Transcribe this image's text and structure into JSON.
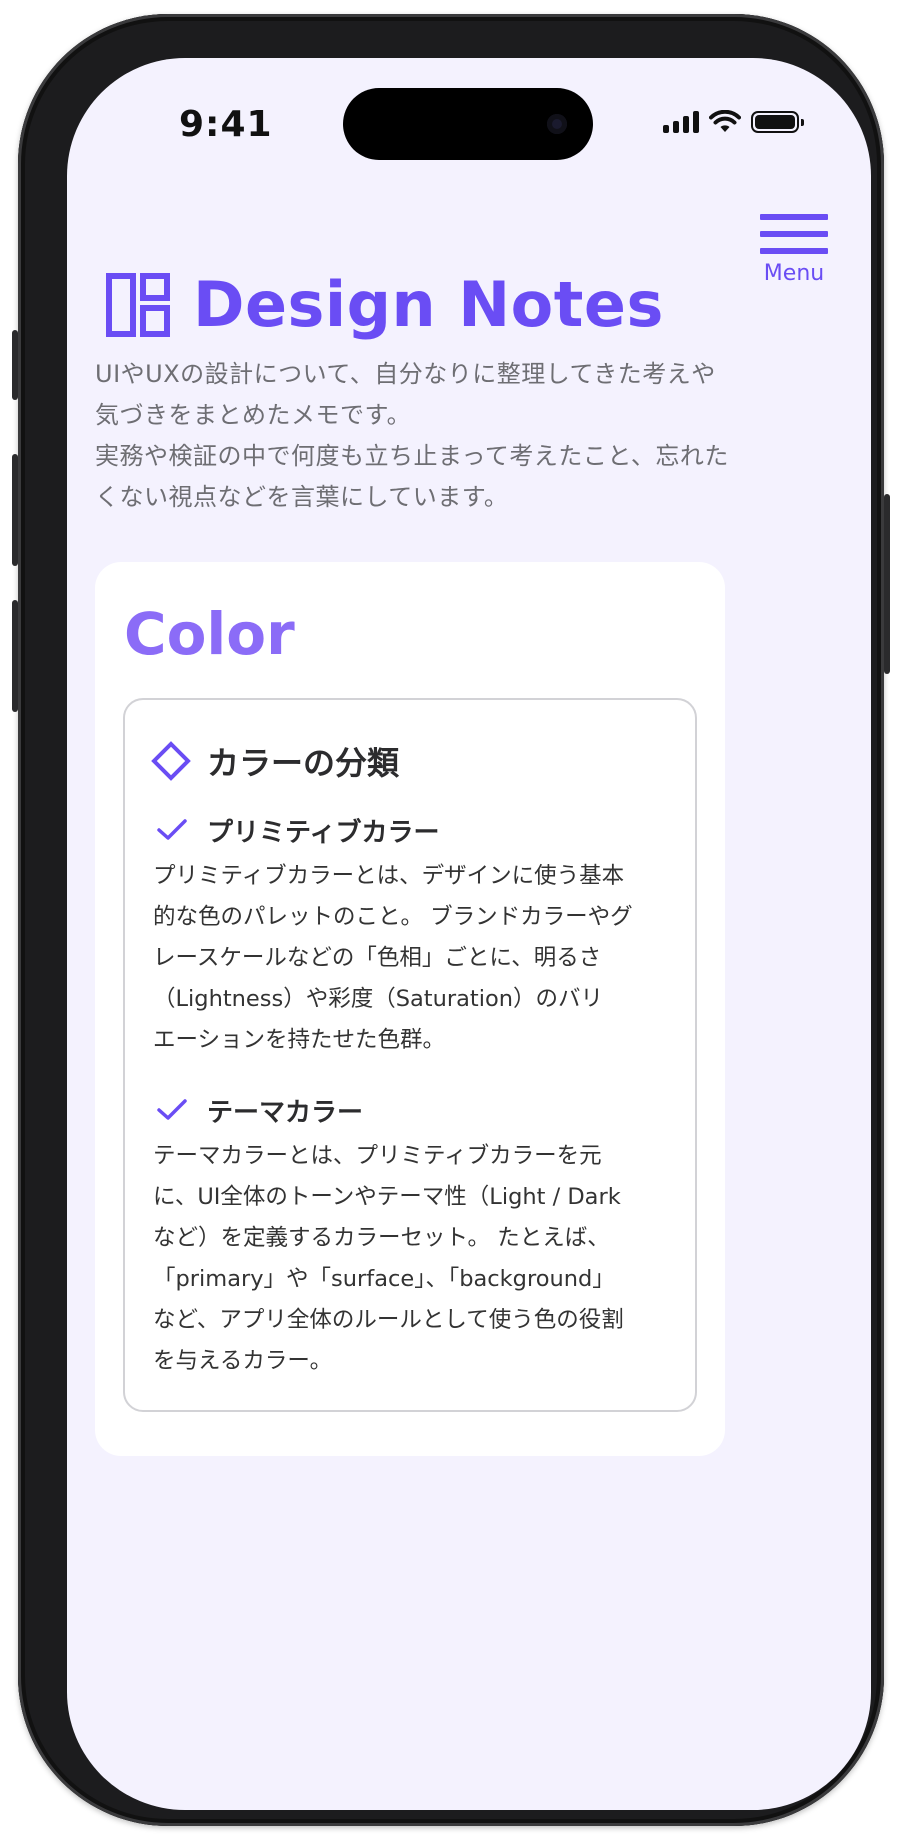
{
  "status_bar": {
    "time": "9:41"
  },
  "menu": {
    "label": "Menu"
  },
  "header": {
    "title": "Design Notes"
  },
  "intro": "UIやUXの設計について、自分なりに整理してきた考えや\n気づきをまとめたメモです。\n実務や検証の中で何度も立ち止まって考えたこと、忘れた\nくない視点などを言葉にしています。",
  "section": {
    "title": "Color",
    "card": {
      "title": "カラーの分類",
      "items": [
        {
          "title": "プリミティブカラー",
          "body": "プリミティブカラーとは、デザインに使う基本\n的な色のパレットのこと。 ブランドカラーやグ\nレースケールなどの「色相」ごとに、明るさ\n（Lightness）や彩度（Saturation）のバリ\nエーションを持たせた色群。"
        },
        {
          "title": "テーマカラー",
          "body": "テーマカラーとは、プリミティブカラーを元\nに、UI全体のトーンやテーマ性（Light / Dark\nなど）を定義するカラーセット。 たとえば、\n「primary」や「surface」、「background」\nなど、アプリ全体のルールとして使う色の役割\nを与えるカラー。"
        }
      ]
    }
  },
  "colors": {
    "accent": "#6a4df4",
    "section_title": "#8b6cf7",
    "screen_bg": "#f4f2fe",
    "text_muted": "#6e6e73"
  }
}
